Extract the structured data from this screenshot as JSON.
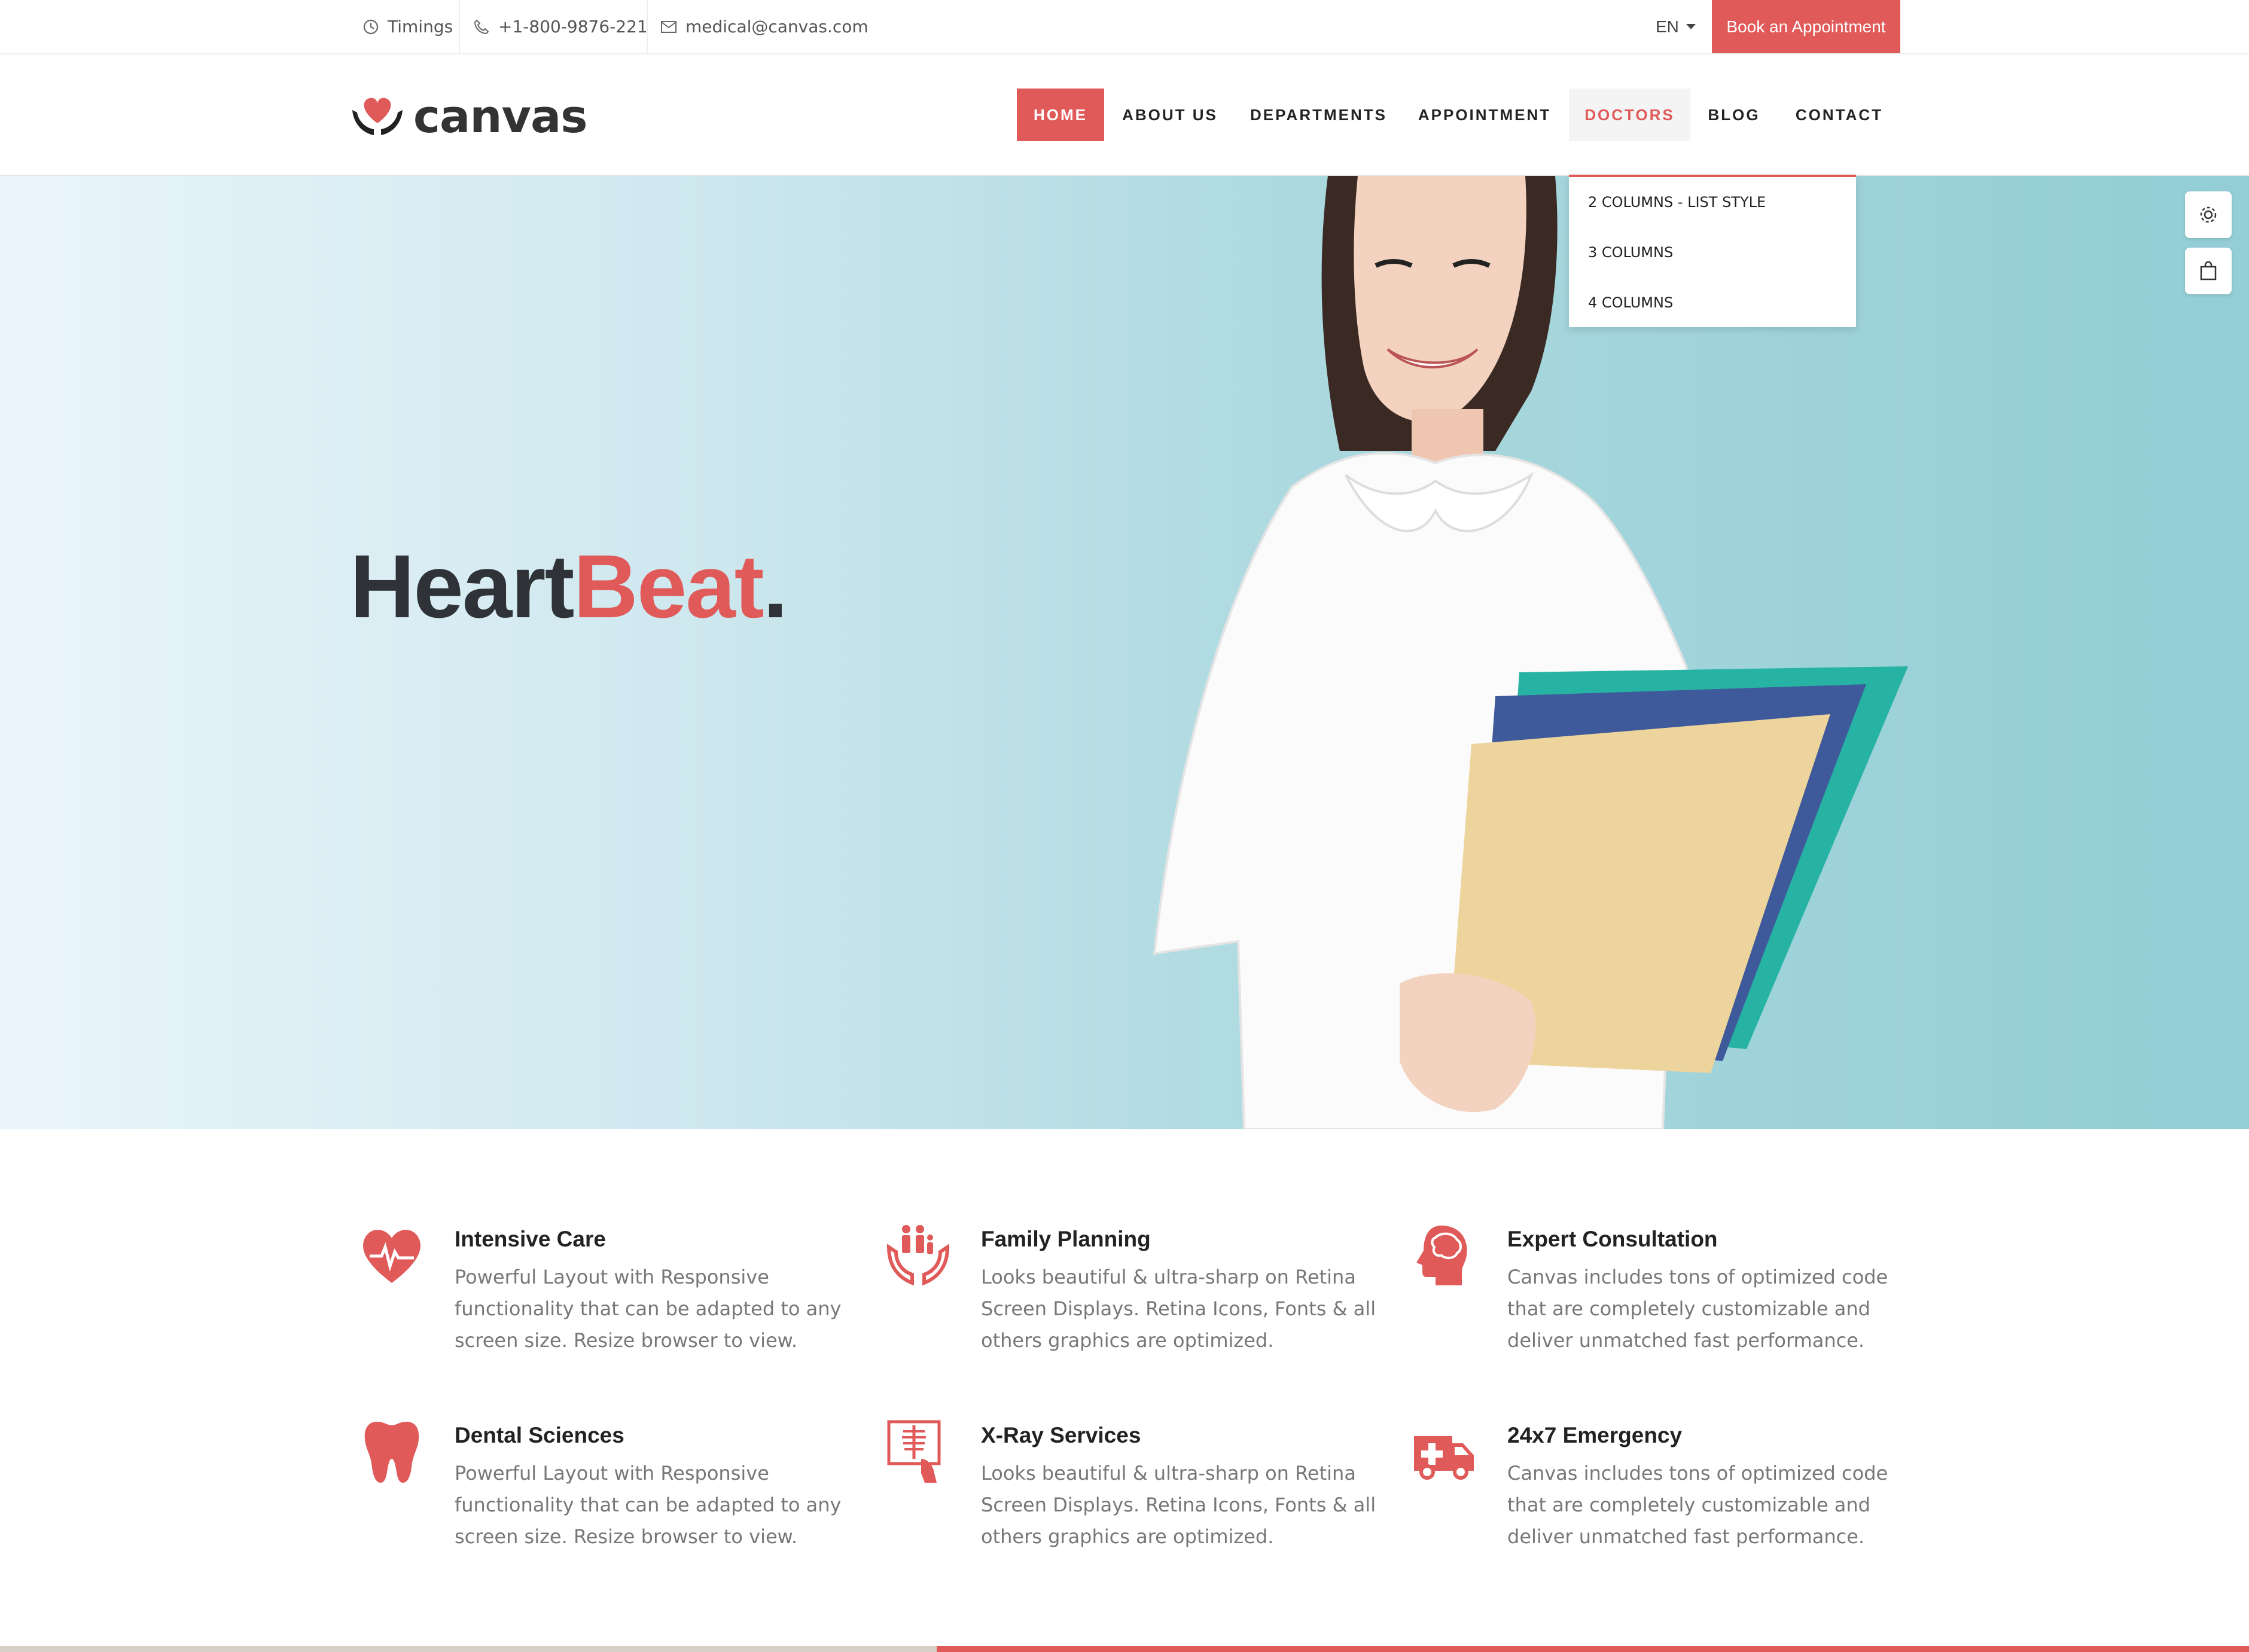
{
  "topbar": {
    "timings": "Timings",
    "phone": "+1-800-9876-221",
    "email": "medical@canvas.com",
    "language": "EN",
    "book_button": "Book an Appointment"
  },
  "brand": {
    "name": "canvas",
    "accent": "#e05a5a"
  },
  "nav": {
    "home": "HOME",
    "about": "ABOUT US",
    "departments": "DEPARTMENTS",
    "appointment": "APPOINTMENT",
    "doctors": "DOCTORS",
    "blog": "BLOG",
    "contact": "CONTACT",
    "doctors_menu": [
      "2 COLUMNS - LIST STYLE",
      "3 COLUMNS",
      "4 COLUMNS"
    ]
  },
  "hero": {
    "title_main": "Heart",
    "title_accent": "Beat",
    "title_dot": "."
  },
  "features": [
    {
      "title": "Intensive Care",
      "text": "Powerful Layout with Responsive functionality that can be adapted to any screen size. Resize browser to view.",
      "icon": "heart-pulse-icon"
    },
    {
      "title": "Family Planning",
      "text": "Looks beautiful & ultra-sharp on Retina Screen Displays. Retina Icons, Fonts & all others graphics are optimized.",
      "icon": "family-hands-icon"
    },
    {
      "title": "Expert Consultation",
      "text": "Canvas includes tons of optimized code that are completely customizable and deliver unmatched fast performance.",
      "icon": "brain-head-icon"
    },
    {
      "title": "Dental Sciences",
      "text": "Powerful Layout with Responsive functionality that can be adapted to any screen size. Resize browser to view.",
      "icon": "tooth-icon"
    },
    {
      "title": "X-Ray Services",
      "text": "Looks beautiful & ultra-sharp on Retina Screen Displays. Retina Icons, Fonts & all others graphics are optimized.",
      "icon": "xray-icon"
    },
    {
      "title": "24x7 Emergency",
      "text": "Canvas includes tons of optimized code that are completely customizable and deliver unmatched fast performance.",
      "icon": "ambulance-icon"
    }
  ]
}
